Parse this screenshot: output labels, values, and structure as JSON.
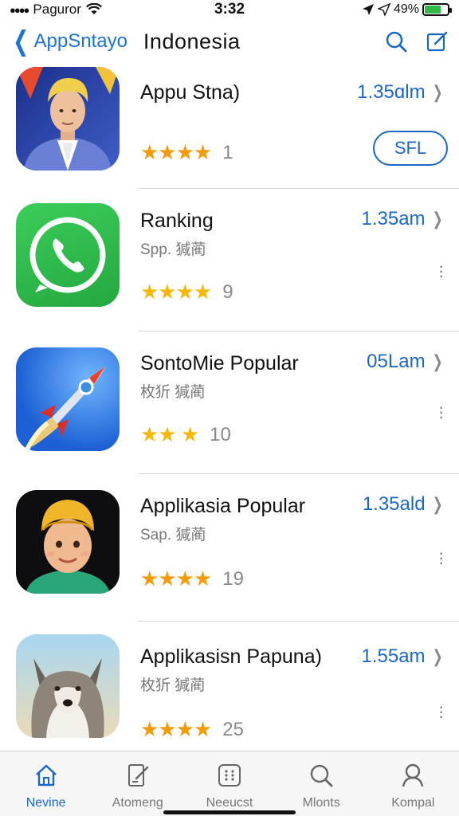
{
  "status": {
    "carrier": "Paguror",
    "time": "3:32",
    "battery": "49%"
  },
  "nav": {
    "back_label": "AppSntayo",
    "title": "Indonesia"
  },
  "apps": [
    {
      "name": "Appu Stna)",
      "subtitle": "",
      "stars": "★★★★",
      "rating_count": "1",
      "time": "1.35ɑlm",
      "button": "SFL"
    },
    {
      "name": "Ranking",
      "subtitle": "Spp. 㺂蔺",
      "stars": "★★★★",
      "rating_count": "9",
      "time": "1.35am"
    },
    {
      "name": "SontoMie Popular",
      "subtitle": "枚㹞 㺂蔺",
      "stars": "★★ ★",
      "rating_count": "10",
      "time": "05Lam"
    },
    {
      "name": "Applikasia Popular",
      "subtitle": "Sap. 㺂蔺",
      "stars": "★★★★",
      "rating_count": "19",
      "time": "1.35ald"
    },
    {
      "name": "Applikasisn Papuna)",
      "subtitle": "枚㹞 㺂蔺",
      "stars": "★★★★",
      "rating_count": "25",
      "time": "1.55am"
    }
  ],
  "tabs": [
    {
      "label": "Nevine",
      "icon": "home-icon"
    },
    {
      "label": "Atomeng",
      "icon": "edit-icon"
    },
    {
      "label": "Neeucst",
      "icon": "grid-icon"
    },
    {
      "label": "Mlonts",
      "icon": "search-icon"
    },
    {
      "label": "Kompal",
      "icon": "person-icon"
    }
  ],
  "colors": {
    "accent": "#1a66c9",
    "star": "#f39b0a"
  }
}
